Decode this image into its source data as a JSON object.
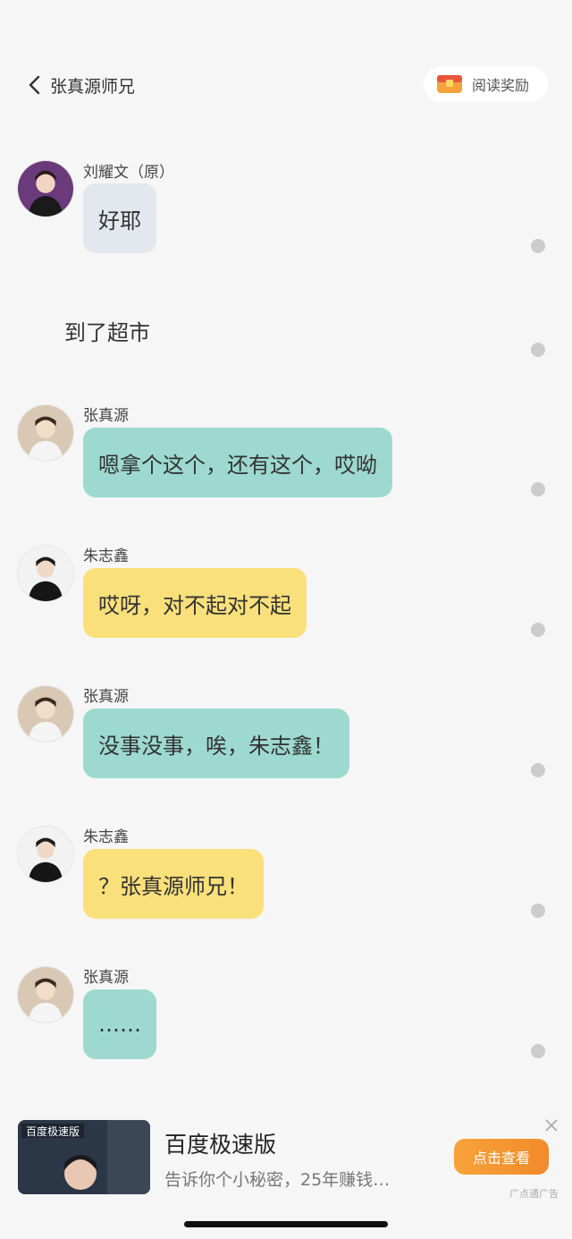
{
  "header": {
    "back_title": "张真源师兄",
    "reward_label": "阅读奖励"
  },
  "messages": [
    {
      "type": "bubble",
      "name": "刘耀文（原）",
      "text": "好耶",
      "color": "gray"
    },
    {
      "type": "narration",
      "text": "到了超市"
    },
    {
      "type": "bubble",
      "name": "张真源",
      "text": "嗯拿个这个，还有这个，哎呦",
      "color": "teal"
    },
    {
      "type": "bubble",
      "name": "朱志鑫",
      "text": "哎呀，对不起对不起",
      "color": "yellow"
    },
    {
      "type": "bubble",
      "name": "张真源",
      "text": "没事没事，唉，朱志鑫！",
      "color": "teal"
    },
    {
      "type": "bubble",
      "name": "朱志鑫",
      "text": "？张真源师兄！",
      "color": "yellow"
    },
    {
      "type": "bubble",
      "name": "张真源",
      "text": "……",
      "color": "teal"
    }
  ],
  "ad": {
    "title": "百度极速版",
    "description": "告诉你个小秘密，25年赚钱…",
    "button_label": "点击查看",
    "source": "广点通广告",
    "thumb_caption": "百度极速版"
  },
  "colors": {
    "background": "#f6f6f6",
    "bubble_gray": "#e3e7ee",
    "bubble_teal": "#9dd9d0",
    "bubble_yellow": "#f9e07b",
    "ad_button": "#f28a2b"
  }
}
